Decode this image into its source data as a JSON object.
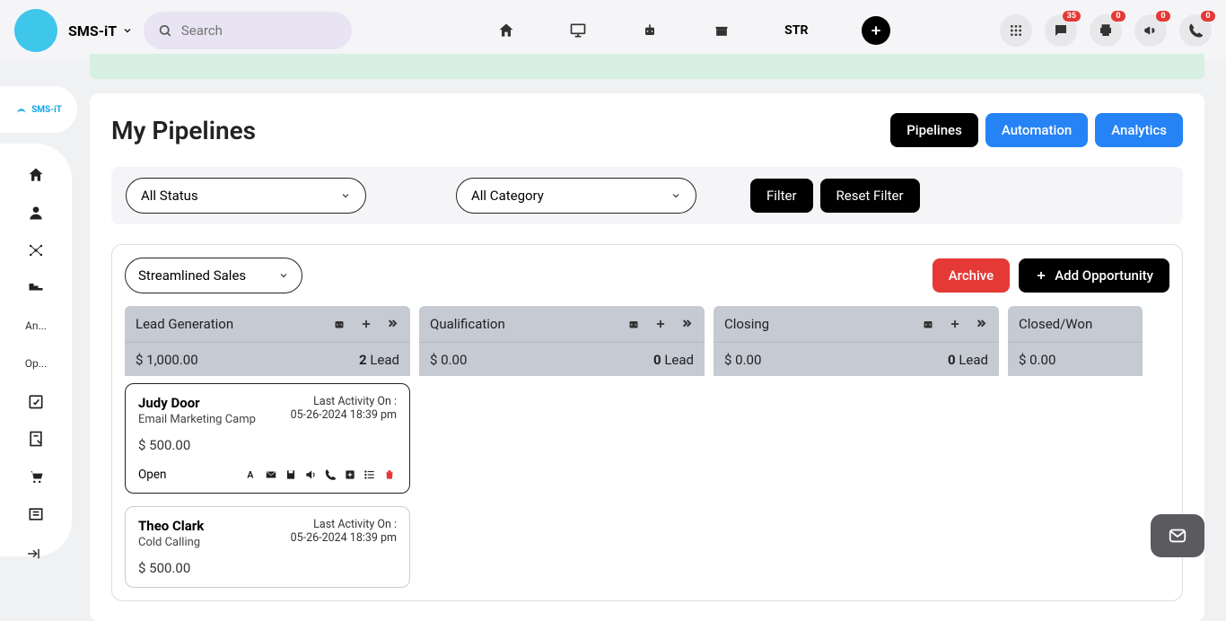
{
  "header": {
    "brand": "SMS-iT",
    "search_placeholder": "Search",
    "str": "STR",
    "badges": {
      "chat": "35",
      "print": "0",
      "announce": "0",
      "phone": "0"
    }
  },
  "sidebar": {
    "logo": "SMS-iT",
    "items": [
      {
        "label": "An..."
      },
      {
        "label": "Op..."
      }
    ]
  },
  "page": {
    "title": "My Pipelines",
    "tabs": {
      "pipelines": "Pipelines",
      "automation": "Automation",
      "analytics": "Analytics"
    },
    "filters": {
      "status": "All Status",
      "category": "All Category",
      "filter_btn": "Filter",
      "reset_btn": "Reset Filter"
    },
    "pipeline": {
      "selected": "Streamlined Sales",
      "archive_btn": "Archive",
      "add_btn": "Add Opportunity",
      "stages": [
        {
          "name": "Lead Generation",
          "amount": "$ 1,000.00",
          "count": "2",
          "count_label": "Lead"
        },
        {
          "name": "Qualification",
          "amount": "$ 0.00",
          "count": "0",
          "count_label": "Lead"
        },
        {
          "name": "Closing",
          "amount": "$ 0.00",
          "count": "0",
          "count_label": "Lead"
        },
        {
          "name": "Closed/Won",
          "amount": "$ 0.00"
        }
      ],
      "cards": [
        {
          "name": "Judy Door",
          "sub": "Email Marketing Camp",
          "activity_label": "Last Activity On :",
          "activity_time": "05-26-2024 18:39 pm",
          "amount": "$ 500.00",
          "status": "Open"
        },
        {
          "name": "Theo Clark",
          "sub": "Cold Calling",
          "activity_label": "Last Activity On :",
          "activity_time": "05-26-2024 18:39 pm",
          "amount": "$ 500.00"
        }
      ]
    }
  }
}
